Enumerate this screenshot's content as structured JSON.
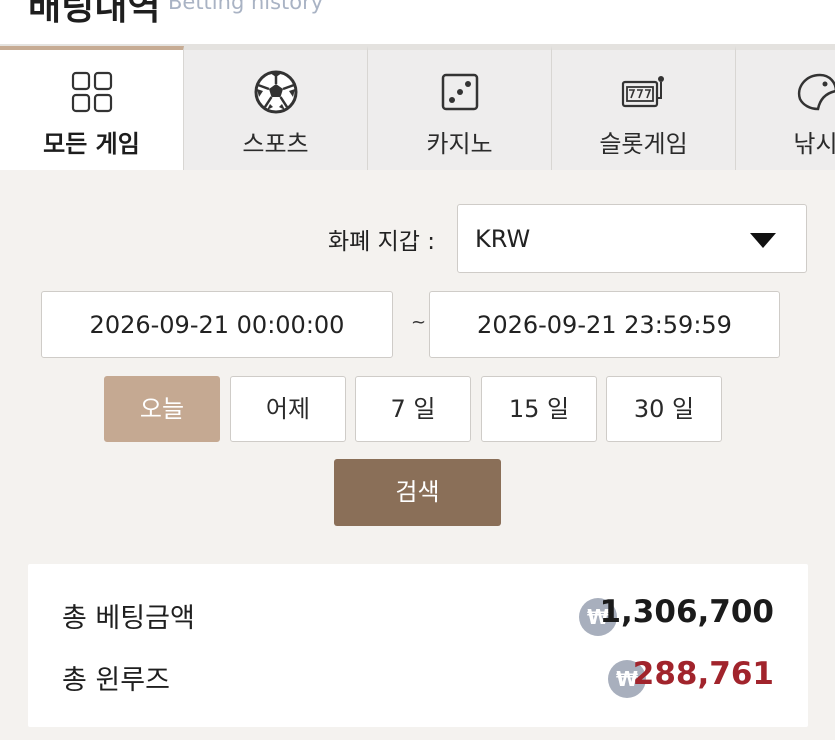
{
  "header": {
    "title": "배팅내역",
    "subtitle": "Betting history"
  },
  "tabs": [
    {
      "id": "all",
      "label": "모든 게임",
      "icon": "grid-icon",
      "active": true
    },
    {
      "id": "sports",
      "label": "스포츠",
      "icon": "soccer-ball-icon",
      "active": false
    },
    {
      "id": "casino",
      "label": "카지노",
      "icon": "dice-icon",
      "active": false
    },
    {
      "id": "slot",
      "label": "슬롯게임",
      "icon": "slot-machine-icon",
      "active": false
    },
    {
      "id": "fishing",
      "label": "낚시",
      "icon": "fish-icon",
      "active": false
    }
  ],
  "filters": {
    "currency_label": "화폐 지갑 :",
    "currency_value": "KRW",
    "date_from": "2026-09-21 00:00:00",
    "date_to": "2026-09-21 23:59:59",
    "separator": "~",
    "ranges": [
      "오늘",
      "어제",
      "7 일",
      "15 일",
      "30 일"
    ],
    "search_label": "검색"
  },
  "summary": {
    "currency_symbol": "₩",
    "total_bet_label": "총 베팅금액",
    "total_bet_value": "1,306,700",
    "total_winloss_label": "총 윈루즈",
    "total_winloss_value": "288,761"
  },
  "colors": {
    "accent": "#c5a992",
    "search_button": "#8a6f58",
    "winloss_text": "#a1242c",
    "coin": "#a8afbd"
  }
}
